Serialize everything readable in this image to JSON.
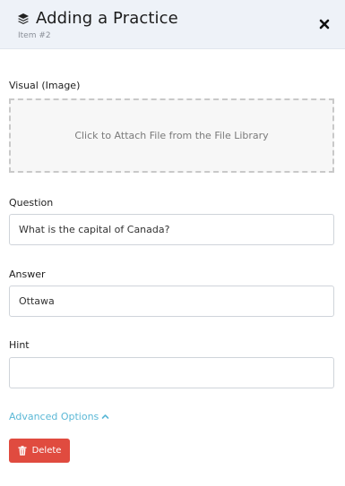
{
  "header": {
    "title": "Adding a Practice",
    "subtitle": "Item #2",
    "title_icon": "stack-icon",
    "close_icon": "close-icon"
  },
  "visual": {
    "label": "Visual (Image)",
    "dropzone_text": "Click to Attach File from the File Library"
  },
  "question": {
    "label": "Question",
    "value": "What is the capital of Canada?"
  },
  "answer": {
    "label": "Answer",
    "value": "Ottawa"
  },
  "hint": {
    "label": "Hint",
    "value": ""
  },
  "advanced": {
    "label": "Advanced Options",
    "icon": "chevron-up-icon"
  },
  "delete": {
    "label": "Delete",
    "icon": "trash-icon"
  },
  "colors": {
    "header_bg": "#eef2f8",
    "accent_link": "#5bb8d6",
    "danger": "#e04b3f"
  }
}
